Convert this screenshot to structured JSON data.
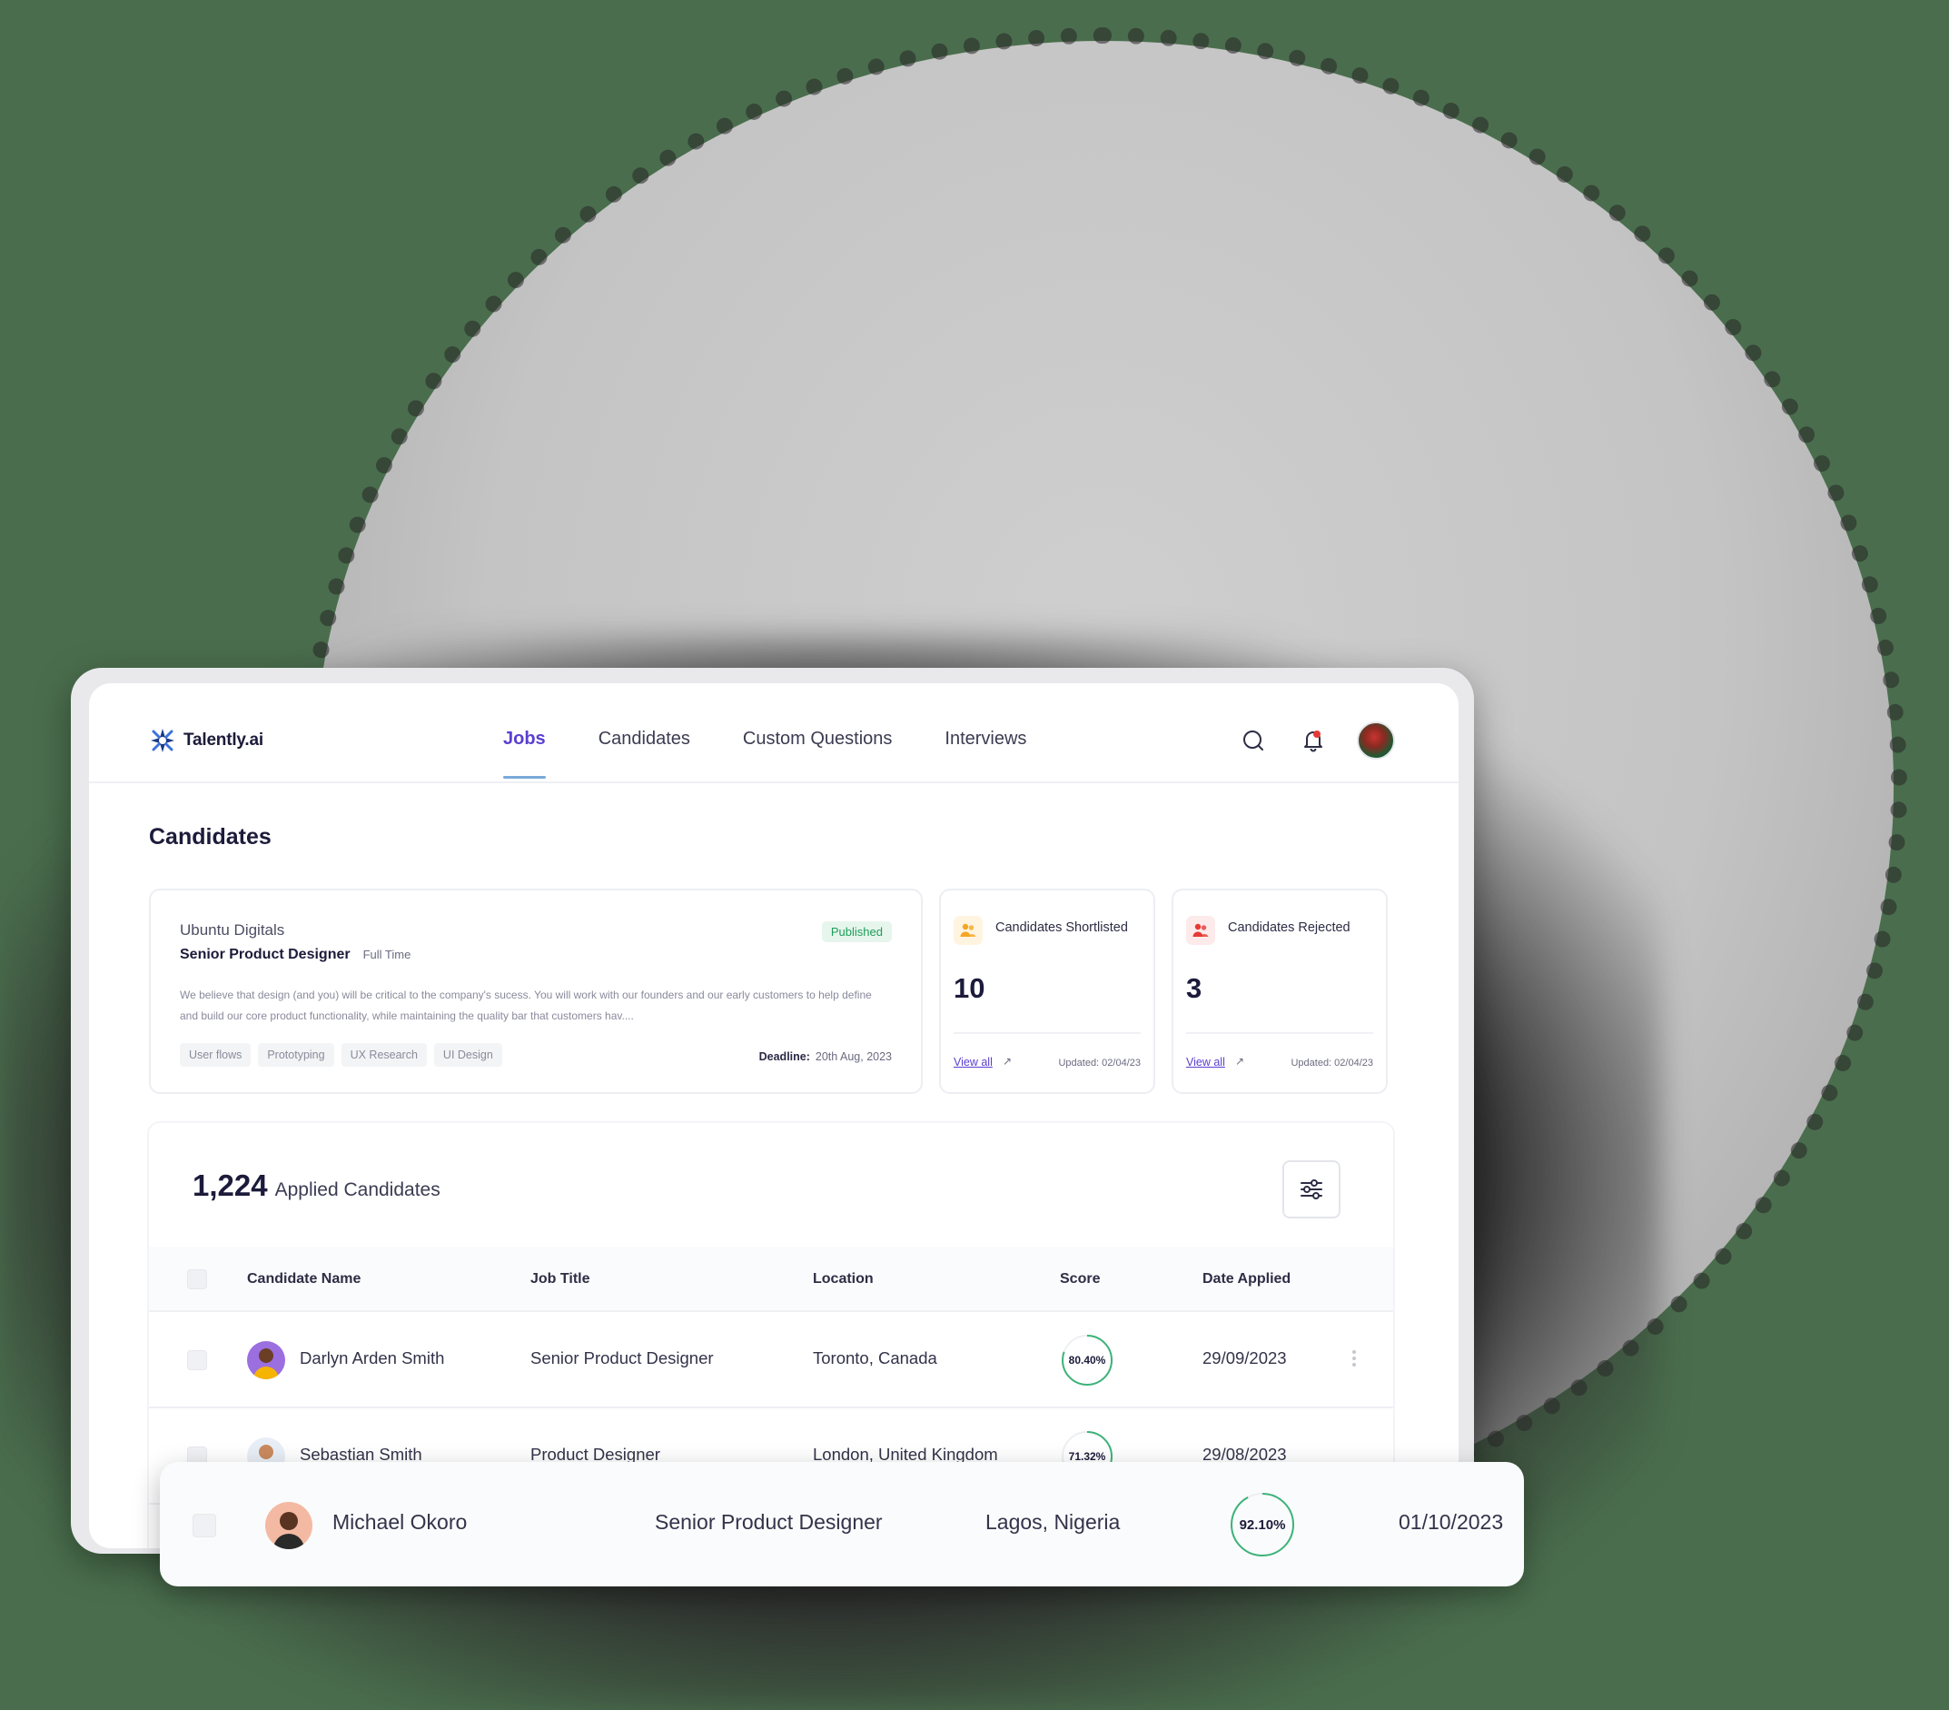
{
  "app": {
    "brand": "Talently.ai"
  },
  "nav": {
    "tabs": [
      {
        "label": "Jobs",
        "active": true
      },
      {
        "label": "Candidates",
        "active": false
      },
      {
        "label": "Custom Questions",
        "active": false
      },
      {
        "label": "Interviews",
        "active": false
      }
    ],
    "icons": [
      "search-icon",
      "bell-icon",
      "avatar"
    ]
  },
  "page": {
    "title": "Candidates"
  },
  "job": {
    "company": "Ubuntu Digitals",
    "title": "Senior Product Designer",
    "type": "Full Time",
    "status": "Published",
    "description": "We believe that design (and you) will be critical to the company's sucess. You will work with our founders and our early customers to help define and build our core product functionality, while maintaining the quality bar that customers hav....",
    "tags": [
      "User flows",
      "Prototyping",
      "UX Research",
      "UI Design"
    ],
    "deadline_label": "Deadline:",
    "deadline_value": "20th Aug, 2023"
  },
  "stats": [
    {
      "label": "Candidates Shortlisted",
      "value": "10",
      "link": "View all",
      "arrow": "↗",
      "updated": "Updated: 02/04/23",
      "accent": "#f5a623",
      "icon": "users-icon"
    },
    {
      "label": "Candidates Rejected",
      "value": "3",
      "link": "View all",
      "arrow": "↗",
      "updated": "Updated: 02/04/23",
      "accent": "#e53935",
      "icon": "users-icon"
    }
  ],
  "table": {
    "count": "1,224",
    "count_label": "Applied Candidates",
    "columns": [
      "Candidate Name",
      "Job Title",
      "Location",
      "Score",
      "Date Applied"
    ],
    "rows": [
      {
        "name": "Darlyn Arden Smith",
        "job": "Senior Product Designer",
        "location": "Toronto, Canada",
        "score": "80.40%",
        "score_value": 0.804,
        "date": "29/09/2023"
      },
      {
        "name": "Sebastian Smith",
        "job": "Product Designer",
        "location": "London, United Kingdom",
        "score": "71.32%",
        "score_value": 0.7132,
        "date": "29/08/2023"
      }
    ]
  },
  "highlight": {
    "name": "Michael Okoro",
    "job": "Senior Product Designer",
    "location": "Lagos, Nigeria",
    "score": "92.10%",
    "score_value": 0.921,
    "date": "01/10/2023"
  },
  "colors": {
    "accent": "#5b3fd1",
    "success": "#1e9e5a",
    "score_ring": "#3db37a"
  }
}
